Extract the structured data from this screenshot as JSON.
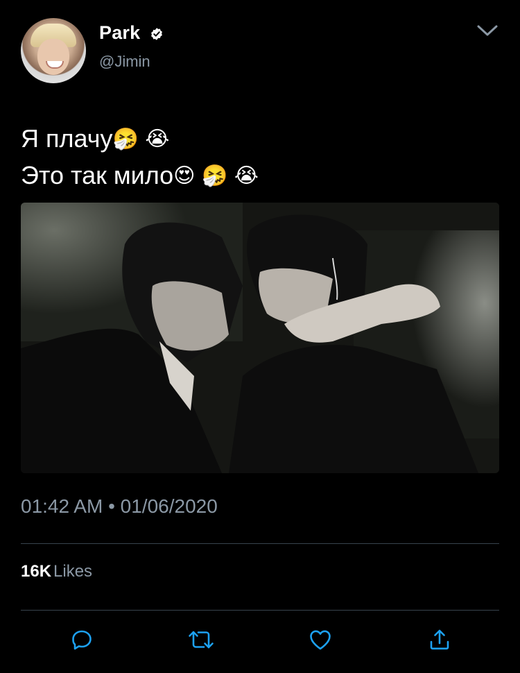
{
  "tweet": {
    "author": {
      "display_name": "Park",
      "username": "@Jimin",
      "verified": true
    },
    "text_lines": [
      {
        "text": "Я плачу",
        "emojis": "🤧 😭"
      },
      {
        "text": "Это так мило",
        "emojis": "😍 🤧 😭"
      }
    ],
    "media": {
      "type": "photo"
    },
    "timestamp": "01:42 AM • 01/06/2020",
    "stats": {
      "likes_count": "16K",
      "likes_label": "Likes"
    },
    "actions": [
      "reply-icon",
      "retweet-icon",
      "like-icon",
      "share-icon"
    ]
  },
  "colors": {
    "background": "#000000",
    "text_primary": "#ffffff",
    "text_secondary": "#8b98a5",
    "divider": "#38444d",
    "icon_accent": "#1da1f2"
  },
  "icons": {
    "verified": "verified-badge-icon",
    "menu": "chevron-down-icon"
  }
}
